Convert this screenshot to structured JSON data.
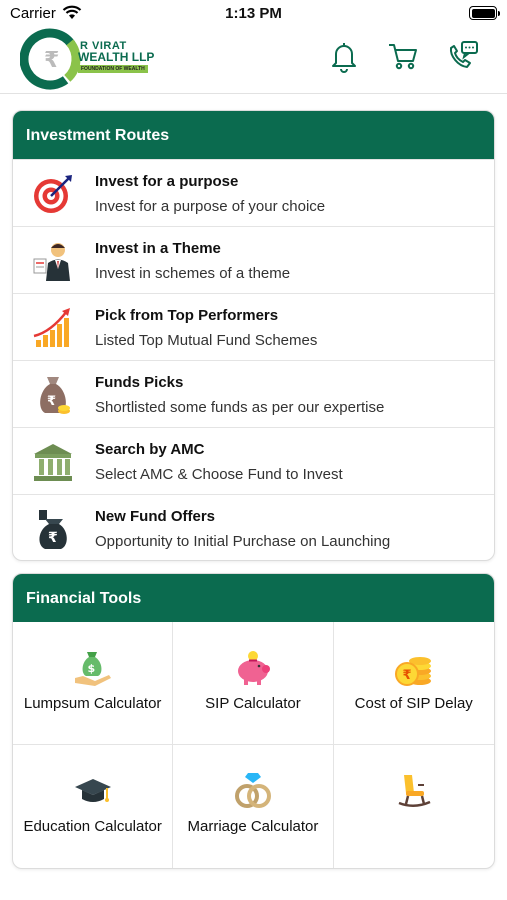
{
  "status_bar": {
    "carrier": "Carrier",
    "time": "1:13 PM"
  },
  "header": {
    "logo": {
      "name_line1": "R VIRAT",
      "name_line2": "WEALTH LLP",
      "tagline": "FOUNDATION OF WEALTH"
    },
    "icons": [
      "bell-icon",
      "cart-icon",
      "chat-phone-icon"
    ]
  },
  "investment_routes": {
    "title": "Investment Routes",
    "items": [
      {
        "title": "Invest for a purpose",
        "subtitle": "Invest for a purpose of your choice",
        "icon": "target-icon"
      },
      {
        "title": "Invest in a Theme",
        "subtitle": "Invest in schemes of a theme",
        "icon": "businessman-icon"
      },
      {
        "title": "Pick from Top Performers",
        "subtitle": "Listed Top Mutual Fund Schemes",
        "icon": "growth-chart-icon"
      },
      {
        "title": "Funds Picks",
        "subtitle": "Shortlisted some funds as per our expertise",
        "icon": "money-bag-icon"
      },
      {
        "title": "Search by AMC",
        "subtitle": "Select AMC & Choose Fund to Invest",
        "icon": "bank-icon"
      },
      {
        "title": "New Fund Offers",
        "subtitle": "Opportunity to Initial Purchase on Launching",
        "icon": "rupee-bag-icon"
      }
    ]
  },
  "financial_tools": {
    "title": "Financial Tools",
    "items": [
      {
        "label": "Lumpsum Calculator",
        "icon": "money-hand-icon"
      },
      {
        "label": "SIP Calculator",
        "icon": "piggy-bank-icon"
      },
      {
        "label": "Cost of SIP Delay",
        "icon": "coins-icon"
      },
      {
        "label": "Education Calculator",
        "icon": "graduation-cap-icon"
      },
      {
        "label": "Marriage Calculator",
        "icon": "rings-icon"
      },
      {
        "label": "",
        "icon": "rocking-chair-icon"
      }
    ]
  },
  "colors": {
    "brand_green": "#0b6b4f",
    "accent_lime": "#8bc34a",
    "divider": "#e4e4e4"
  }
}
